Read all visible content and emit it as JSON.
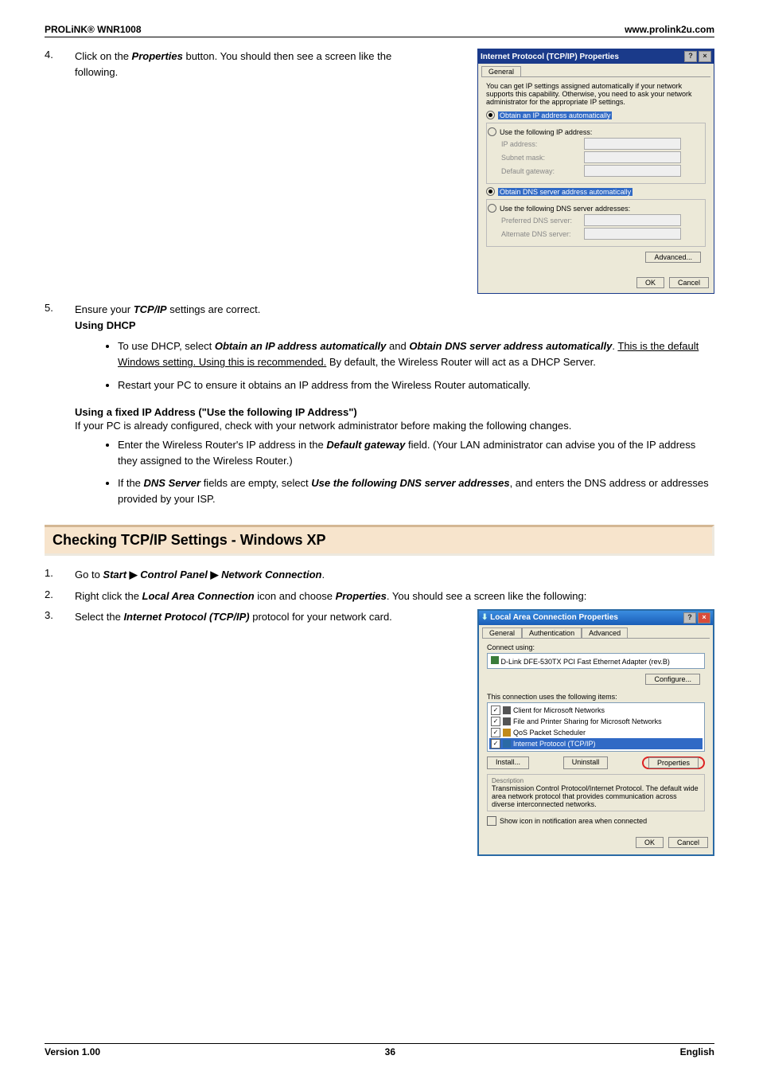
{
  "header": {
    "left": "PROLiNK® WNR1008",
    "right": "www.prolink2u.com"
  },
  "step4": {
    "num": "4.",
    "p1_a": "Click on the ",
    "p1_b": "Properties",
    "p1_c": " button. You should then see a screen like the following."
  },
  "dialog1": {
    "title": "Internet Protocol (TCP/IP) Properties",
    "qmark": "?",
    "close": "×",
    "tab_general": "General",
    "intro": "You can get IP settings assigned automatically if your network supports this capability. Otherwise, you need to ask your network administrator for the appropriate IP settings.",
    "r_auto_ip": "Obtain an IP address automatically",
    "r_use_ip": "Use the following IP address:",
    "f_ip": "IP address:",
    "f_mask": "Subnet mask:",
    "f_gw": "Default gateway:",
    "r_auto_dns": "Obtain DNS server address automatically",
    "r_use_dns": "Use the following DNS server addresses:",
    "f_pdns": "Preferred DNS server:",
    "f_adns": "Alternate DNS server:",
    "advanced": "Advanced...",
    "ok": "OK",
    "cancel": "Cancel"
  },
  "step5": {
    "num": "5.",
    "line1_a": "Ensure your ",
    "line1_b": "TCP/IP",
    "line1_c": " settings are correct.",
    "using_dhcp": "Using DHCP",
    "b1_a": "To use DHCP, select ",
    "b1_b": "Obtain an IP address automatically",
    "b1_c": " and ",
    "b1_d": "Obtain DNS server address automatically",
    "b1_e": ". ",
    "b1_f": "This is the default Windows setting. Using this is recommended.",
    "b1_g": " By default, the Wireless Router will act as a DHCP Server.",
    "b2": "Restart your PC to ensure it obtains an IP address from the Wireless Router automatically.",
    "using_fixed": "Using a fixed IP Address (\"Use the following IP Address\")",
    "fixed_intro": "If your PC is already configured, check with your network administrator before making the following changes.",
    "fb1_a": "Enter the Wireless Router's IP address in the ",
    "fb1_b": "Default gateway",
    "fb1_c": " field. (Your LAN administrator can advise you of the IP address they assigned to the Wireless Router.)",
    "fb2_a": "If the ",
    "fb2_b": "DNS Server",
    "fb2_c": " fields are empty, select ",
    "fb2_d": "Use the following DNS server addresses",
    "fb2_e": ", and enters the DNS address or addresses provided by your ISP."
  },
  "heading": "Checking TCP/IP Settings - Windows XP",
  "xp": {
    "s1_num": "1.",
    "s1_a": "Go to ",
    "s1_b": "Start",
    "arrow": "▶",
    "s1_c": "Control Panel",
    "s1_d": "Network Connection",
    "s1_e": ".",
    "s2_num": "2.",
    "s2_a": "Right click the ",
    "s2_b": "Local Area Connection",
    "s2_c": " icon and choose ",
    "s2_d": "Properties",
    "s2_e": ". You should see a screen like the following:",
    "s3_num": "3.",
    "s3_a": "Select the ",
    "s3_b": "Internet Protocol (TCP/IP)",
    "s3_c": " protocol for your network card."
  },
  "dialog2": {
    "title": "Local Area Connection Properties",
    "qmark": "?",
    "close": "×",
    "tab_general": "General",
    "tab_auth": "Authentication",
    "tab_adv": "Advanced",
    "connect_using": "Connect using:",
    "adapter": "D-Link DFE-530TX PCI Fast Ethernet Adapter (rev.B)",
    "configure": "Configure...",
    "uses": "This connection uses the following items:",
    "item_client": "Client for Microsoft Networks",
    "item_fps": "File and Printer Sharing for Microsoft Networks",
    "item_qos": "QoS Packet Scheduler",
    "item_tcpip": "Internet Protocol (TCP/IP)",
    "install": "Install...",
    "uninstall": "Uninstall",
    "properties": "Properties",
    "desc_label": "Description",
    "desc": "Transmission Control Protocol/Internet Protocol. The default wide area network protocol that provides communication across diverse interconnected networks.",
    "show_icon": "Show icon in notification area when connected",
    "ok": "OK",
    "cancel": "Cancel"
  },
  "footer": {
    "left": "Version 1.00",
    "center": "36",
    "right": "English"
  }
}
